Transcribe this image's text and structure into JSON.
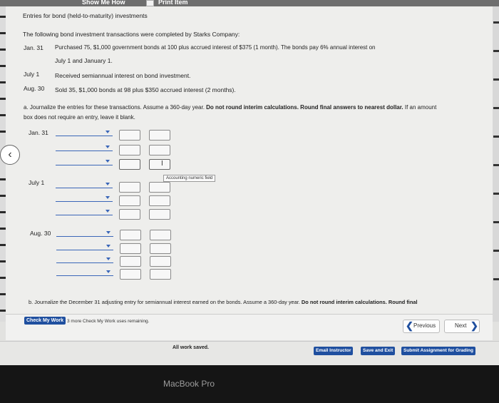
{
  "toolbar": {
    "show_me_how": "Show Me How",
    "print_item": "Print Item"
  },
  "title": "Entries for bond (held-to-maturity) investments",
  "intro": "The following bond investment transactions were completed by Starks Company:",
  "transactions": [
    {
      "date": "Jan. 31",
      "text": "Purchased 75, $1,000 government bonds at 100 plus accrued interest of $375 (1 month). The bonds pay 6% annual interest on",
      "text2": "July 1 and January 1."
    },
    {
      "date": "July 1",
      "text": "Received semiannual interest on bond investment."
    },
    {
      "date": "Aug. 30",
      "text": "Sold 35, $1,000 bonds at 98 plus $350 accrued interest (2 months)."
    }
  ],
  "part_a": {
    "prefix": "a. Journalize the entries for these transactions. Assume a 360-day year.",
    "bold": "Do not round interim calculations. Round final answers to nearest dollar.",
    "suffix": "If an amount",
    "line2": "box does not require an entry, leave it blank."
  },
  "journal": [
    {
      "date": "Jan. 31"
    },
    {
      "date": "July 1"
    },
    {
      "date": "Aug. 30"
    }
  ],
  "tooltip": "Accounting numeric field",
  "part_b": {
    "prefix": "b. Journalize the December 31 adjusting entry for semiannual interest earned on the bonds. Assume a 360-day year.",
    "bold": "Do not round interim calculations. Round final"
  },
  "footer": {
    "check_my_work": "Check My Work",
    "remaining": "3 more Check My Work uses remaining.",
    "previous": "Previous",
    "next": "Next",
    "saved": "All work saved.",
    "email": "Email Instructor",
    "save_exit": "Save and Exit",
    "submit": "Submit Assignment for Grading"
  },
  "device": "MacBook Pro"
}
